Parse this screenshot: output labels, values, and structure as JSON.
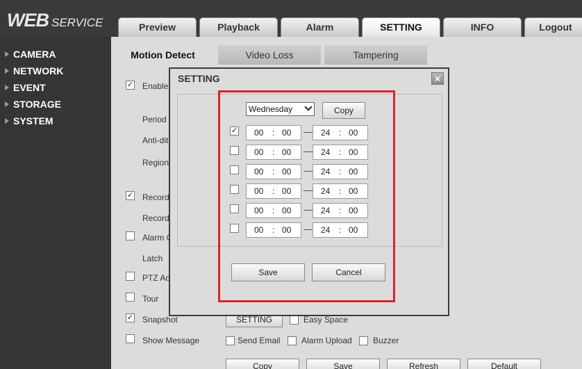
{
  "logo": {
    "big": "WEB",
    "small": "SERVICE"
  },
  "top_nav": [
    "Preview",
    "Playback",
    "Alarm",
    "SETTING",
    "INFO",
    "Logout"
  ],
  "top_nav_active": "SETTING",
  "sidebar": [
    "CAMERA",
    "NETWORK",
    "EVENT",
    "STORAGE",
    "SYSTEM"
  ],
  "sub_tabs": [
    "Motion Detect",
    "Video Loss",
    "Tampering"
  ],
  "sub_tab_active": "Motion Detect",
  "labels": {
    "enable": "Enable",
    "period": "Period",
    "anti_dither": "Anti-dit",
    "region": "Region",
    "record": "Record",
    "record_delay": "Record",
    "alarm_out": "Alarm C",
    "latch": "Latch",
    "ptz": "PTZ Ac",
    "tour": "Tour",
    "snapshot": "Snapshot",
    "show_message": "Show Message",
    "easy_space": "Easy Space",
    "send_email": "Send Email",
    "alarm_upload": "Alarm Upload",
    "buzzer": "Buzzer"
  },
  "checked": {
    "enable": true,
    "record": true,
    "alarm_out": false,
    "ptz": false,
    "tour": false,
    "snapshot": true,
    "show_message": false,
    "easy_space": false,
    "send_email": false,
    "alarm_upload": false,
    "buzzer": false
  },
  "setting_button": "SETTING",
  "bottom_buttons": [
    "Copy",
    "Save",
    "Refresh",
    "Default"
  ],
  "dialog": {
    "title": "SETTING",
    "close": "×",
    "day": "Wednesday",
    "copy_button": "Copy",
    "periods": [
      {
        "enabled": true,
        "start_h": "00",
        "start_m": "00",
        "end_h": "24",
        "end_m": "00"
      },
      {
        "enabled": false,
        "start_h": "00",
        "start_m": "00",
        "end_h": "24",
        "end_m": "00"
      },
      {
        "enabled": false,
        "start_h": "00",
        "start_m": "00",
        "end_h": "24",
        "end_m": "00"
      },
      {
        "enabled": false,
        "start_h": "00",
        "start_m": "00",
        "end_h": "24",
        "end_m": "00"
      },
      {
        "enabled": false,
        "start_h": "00",
        "start_m": "00",
        "end_h": "24",
        "end_m": "00"
      },
      {
        "enabled": false,
        "start_h": "00",
        "start_m": "00",
        "end_h": "24",
        "end_m": "00"
      }
    ],
    "separator": ":",
    "save_button": "Save",
    "cancel_button": "Cancel"
  },
  "colors": {
    "highlight": "#e21f26",
    "header_bg": "#3a3a3a",
    "sidebar_bg": "#353535"
  }
}
